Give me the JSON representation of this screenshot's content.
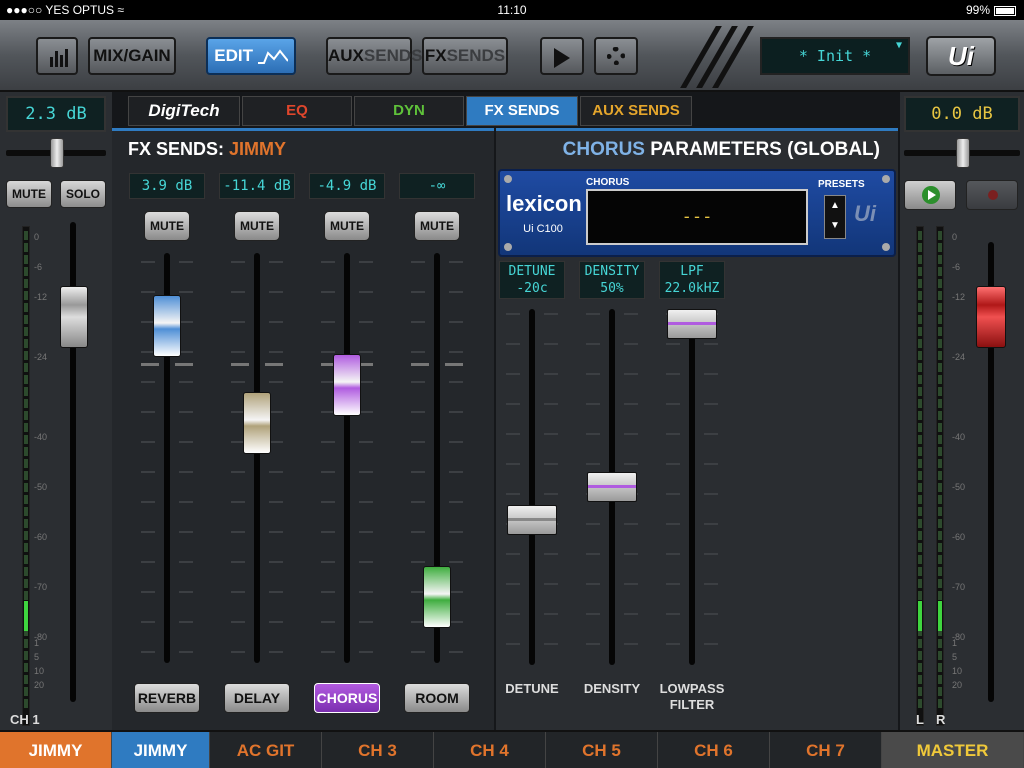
{
  "status": {
    "carrier": "YES OPTUS",
    "time": "11:10",
    "battery": "99%"
  },
  "toolbar": {
    "mix_gain": "MIX/GAIN",
    "edit": "EDIT",
    "aux_a": "AUX",
    "aux_b": "SENDS",
    "fx_a": "FX",
    "fx_b": "SENDS",
    "preset": "* Init *",
    "logo": "Ui"
  },
  "left_strip": {
    "gain": "2.3 dB",
    "mute": "MUTE",
    "solo": "SOLO",
    "channel_label": "CH 1",
    "fader_level_db": -17,
    "meter_level_db": -74,
    "scale": [
      "0",
      "-6",
      "-12",
      "-24",
      "-40",
      "-50",
      "-60",
      "-70",
      "-80",
      "1",
      "5",
      "10",
      "20"
    ]
  },
  "tabs": {
    "brand": "DigiTech",
    "eq": "EQ",
    "dyn": "DYN",
    "fx_sends": "FX SENDS",
    "aux_sends": "AUX SENDS"
  },
  "fx_sends": {
    "title_prefix": "FX SENDS:",
    "channel_name": "JIMMY",
    "sends": [
      {
        "level": "3.9 dB",
        "mute": "MUTE",
        "name": "REVERB",
        "color": "#4f8fd6",
        "fader_pos": 0.12,
        "active": false
      },
      {
        "level": "-11.4 dB",
        "mute": "MUTE",
        "name": "DELAY",
        "color": "#b0a27a",
        "fader_pos": 0.4,
        "active": false
      },
      {
        "level": "-4.9 dB",
        "mute": "MUTE",
        "name": "CHORUS",
        "color": "#b05ce0",
        "fader_pos": 0.29,
        "active": true
      },
      {
        "level": "-∞",
        "mute": "MUTE",
        "name": "ROOM",
        "color": "#3fae3f",
        "fader_pos": 0.9,
        "active": false
      }
    ]
  },
  "params": {
    "title_accent": "CHORUS",
    "title_rest": "PARAMETERS (GLOBAL)",
    "lexicon_logo": "lexicon",
    "lexicon_model": "Ui C100",
    "chorus_label": "CHORUS",
    "chorus_value": "---",
    "presets_label": "PRESETS",
    "brand": "Ui",
    "items": [
      {
        "disp_top": "DETUNE",
        "disp_bottom": "-20c",
        "label": "DETUNE",
        "pos": 0.6,
        "accent": false
      },
      {
        "disp_top": "DENSITY",
        "disp_bottom": "50%",
        "label": "DENSITY",
        "pos": 0.5,
        "accent": true
      },
      {
        "disp_top": "LPF",
        "disp_bottom": "22.0kHZ",
        "label": "LOWPASS FILTER",
        "pos": 0.0,
        "accent": true
      }
    ]
  },
  "master": {
    "level": "0.0 dB",
    "label_l": "L",
    "label_r": "R",
    "fader_level_db": -15,
    "meter_level_db": -74
  },
  "bottom_tabs": [
    "JIMMY",
    "JIMMY",
    "AC GIT",
    "CH 3",
    "CH 4",
    "CH 5",
    "CH 6",
    "CH 7",
    "MASTER"
  ]
}
